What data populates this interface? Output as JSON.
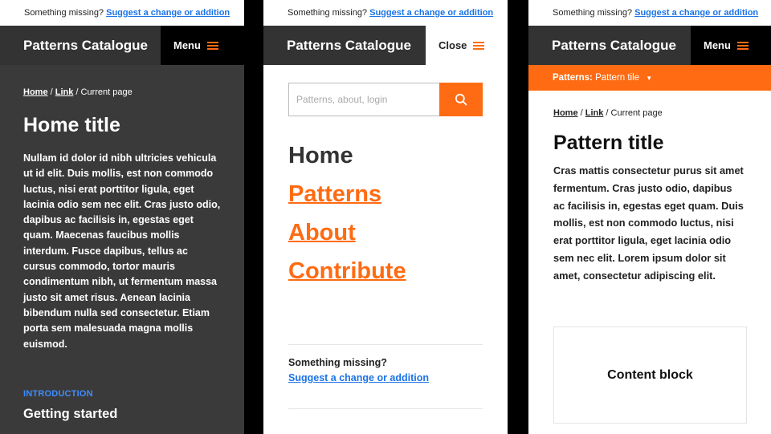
{
  "notice": {
    "text": "Something missing?",
    "link": "Suggest a change or addition"
  },
  "brand": "Patterns Catalogue",
  "menu_label": "Menu",
  "close_label": "Close",
  "breadcrumb": {
    "home": "Home",
    "link": "Link",
    "current": "Current page"
  },
  "panel1": {
    "title": "Home title",
    "body": "Nullam id dolor id nibh ultricies vehicula ut id elit. Duis mollis, est non commodo luctus, nisi erat porttitor ligula, eget lacinia odio sem nec elit. Cras justo odio, dapibus ac facilisis in, egestas eget quam. Maecenas faucibus mollis interdum. Fusce dapibus, tellus ac cursus commodo, tortor mauris condimentum nibh, ut fermentum massa justo sit amet risus. Aenean lacinia bibendum nulla sed consectetur. Etiam porta sem malesuada magna mollis euismod.",
    "eyebrow": "INTRODUCTION",
    "section": "Getting started"
  },
  "panel2": {
    "search_placeholder": "Patterns, about, login",
    "nav": [
      "Home",
      "Patterns",
      "About",
      "Contribute"
    ],
    "missing_q": "Something missing?",
    "missing_link": "Suggest a change or addition"
  },
  "panel3": {
    "bar_label": "Patterns:",
    "bar_value": "Pattern tile",
    "title": "Pattern title",
    "body": "Cras mattis consectetur purus sit amet fermentum. Cras justo odio, dapibus ac facilisis in, egestas eget quam. Duis mollis, est non commodo luctus, nisi erat porttitor ligula, eget lacinia odio sem nec elit. Lorem ipsum dolor sit amet, consectetur adipiscing elit.",
    "block": "Content block"
  },
  "colors": {
    "accent": "#ff6b12",
    "link": "#1a73e8",
    "dark": "#333333",
    "eyebrow": "#3f8dff"
  }
}
